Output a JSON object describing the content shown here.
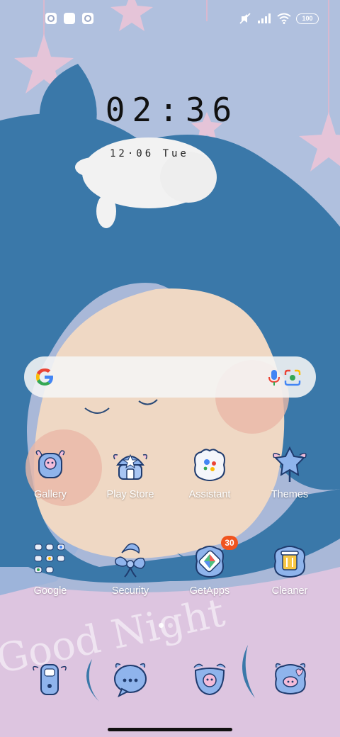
{
  "status_bar": {
    "left_icons": [
      "app-notification-icon",
      "square-notification-icon",
      "app-notification-icon"
    ],
    "right_icons": [
      "mute-icon",
      "signal-icon",
      "wifi-icon"
    ],
    "battery": "100"
  },
  "lock_widget": {
    "time": "02:36",
    "date": "12·06 Tue"
  },
  "search_bar": {
    "logo": "google-g-icon",
    "mic": "mic-icon",
    "lens": "lens-icon"
  },
  "apps_row1": [
    {
      "label": "Gallery",
      "icon": "gallery-icon"
    },
    {
      "label": "Play Store",
      "icon": "play-store-icon"
    },
    {
      "label": "Assistant",
      "icon": "assistant-icon"
    },
    {
      "label": "Themes",
      "icon": "themes-icon"
    }
  ],
  "apps_row2": [
    {
      "label": "Google",
      "icon": "google-folder-icon"
    },
    {
      "label": "Security",
      "icon": "security-icon"
    },
    {
      "label": "GetApps",
      "icon": "getapps-icon",
      "badge": "30"
    },
    {
      "label": "Cleaner",
      "icon": "cleaner-icon"
    }
  ],
  "dock": [
    {
      "icon": "phone-icon"
    },
    {
      "icon": "messages-icon"
    },
    {
      "icon": "camera-icon"
    },
    {
      "icon": "browser-icon"
    }
  ],
  "wallpaper_text": "Good Night",
  "colors": {
    "sky": "#a9b8d8",
    "hair": "#3a78a9",
    "face": "#efd8c4",
    "floor": "#dcc4de",
    "icon_fill": "#8fb4ec",
    "icon_stroke": "#1f3b6e",
    "badge": "#f0541e"
  },
  "page_indicator": {
    "pages": 2,
    "current": 1
  }
}
